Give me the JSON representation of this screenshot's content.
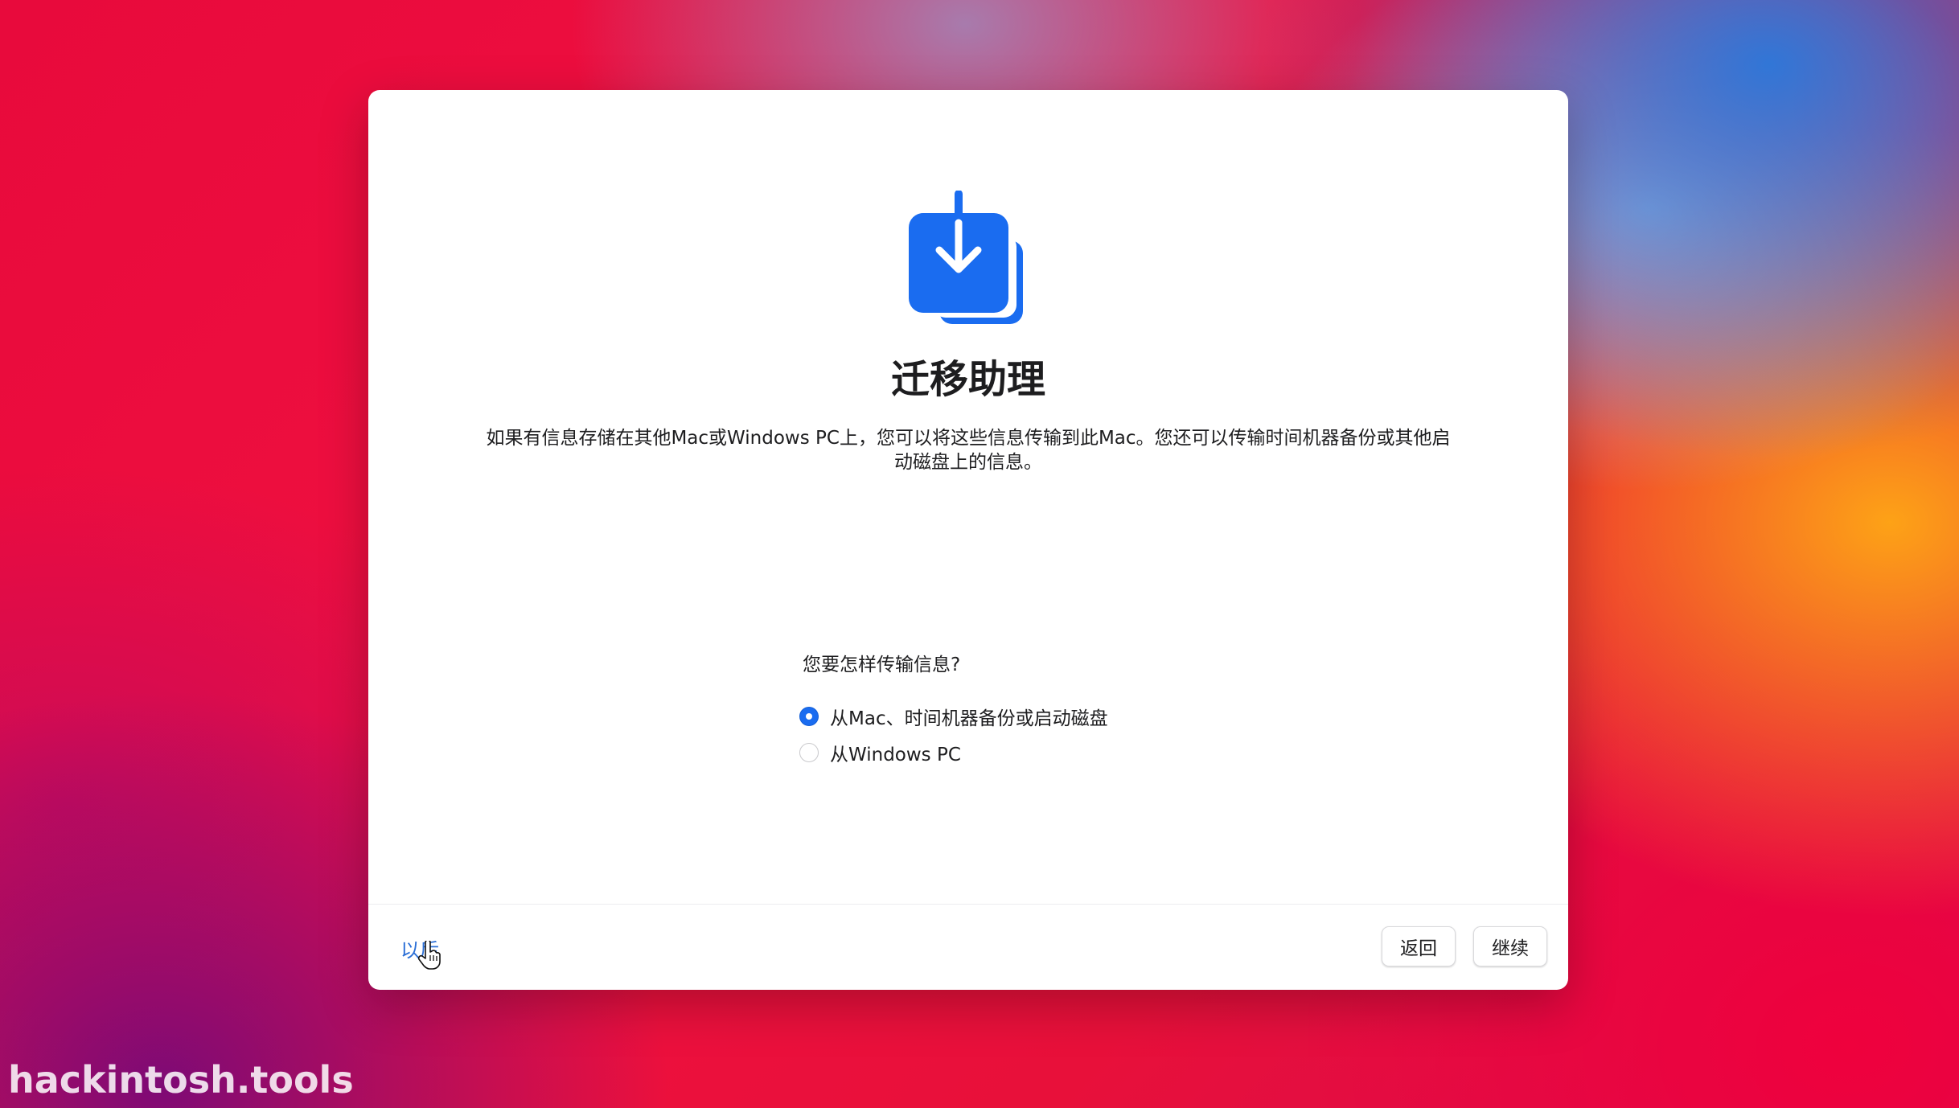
{
  "window": {
    "title": "迁移助理",
    "description": "如果有信息存储在其他Mac或Windows PC上，您可以将这些信息传输到此Mac。您还可以传输时间机器备份或其他启动磁盘上的信息。",
    "icon": "migration-download-icon"
  },
  "transfer": {
    "question": "您要怎样传输信息?",
    "options": [
      {
        "label": "从Mac、时间机器备份或启动磁盘",
        "selected": true
      },
      {
        "label": "从Windows PC",
        "selected": false
      }
    ]
  },
  "footer": {
    "later_label": "以后",
    "back_label": "返回",
    "continue_label": "继续"
  },
  "watermark": "hackintosh.tools",
  "colors": {
    "accent": "#1a6cf0",
    "link": "#2b6fd6",
    "icon_blue": "#1a6cf0"
  }
}
